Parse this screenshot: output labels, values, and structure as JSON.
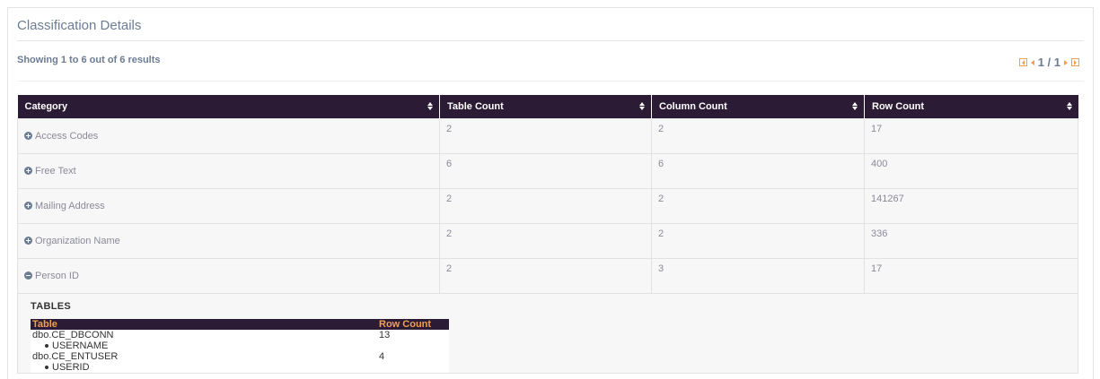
{
  "panel": {
    "title": "Classification Details"
  },
  "summary": {
    "showing": "Showing 1 to 6 out of 6 results"
  },
  "pager": {
    "text": "1 / 1"
  },
  "columns": [
    "Category",
    "Table Count",
    "Column Count",
    "Row Count"
  ],
  "rows": [
    {
      "category": "Access Codes",
      "table_count": "2",
      "column_count": "2",
      "row_count": "17",
      "expanded": false
    },
    {
      "category": "Free Text",
      "table_count": "6",
      "column_count": "6",
      "row_count": "400",
      "expanded": false
    },
    {
      "category": "Mailing Address",
      "table_count": "2",
      "column_count": "2",
      "row_count": "141267",
      "expanded": false
    },
    {
      "category": "Organization Name",
      "table_count": "2",
      "column_count": "2",
      "row_count": "336",
      "expanded": false
    },
    {
      "category": "Person ID",
      "table_count": "2",
      "column_count": "3",
      "row_count": "17",
      "expanded": true
    }
  ],
  "detail": {
    "title": "TABLES",
    "columns": [
      "Table",
      "Row Count"
    ],
    "tables": [
      {
        "name": "dbo.CE_DBCONN",
        "row_count": "13",
        "columns": [
          "USERNAME"
        ]
      },
      {
        "name": "dbo.CE_ENTUSER",
        "row_count": "4",
        "columns": [
          "USERID"
        ]
      }
    ]
  },
  "colors": {
    "header_bg": "#2b1b34",
    "accent": "#f0a050",
    "muted_text": "#6b7c93"
  }
}
